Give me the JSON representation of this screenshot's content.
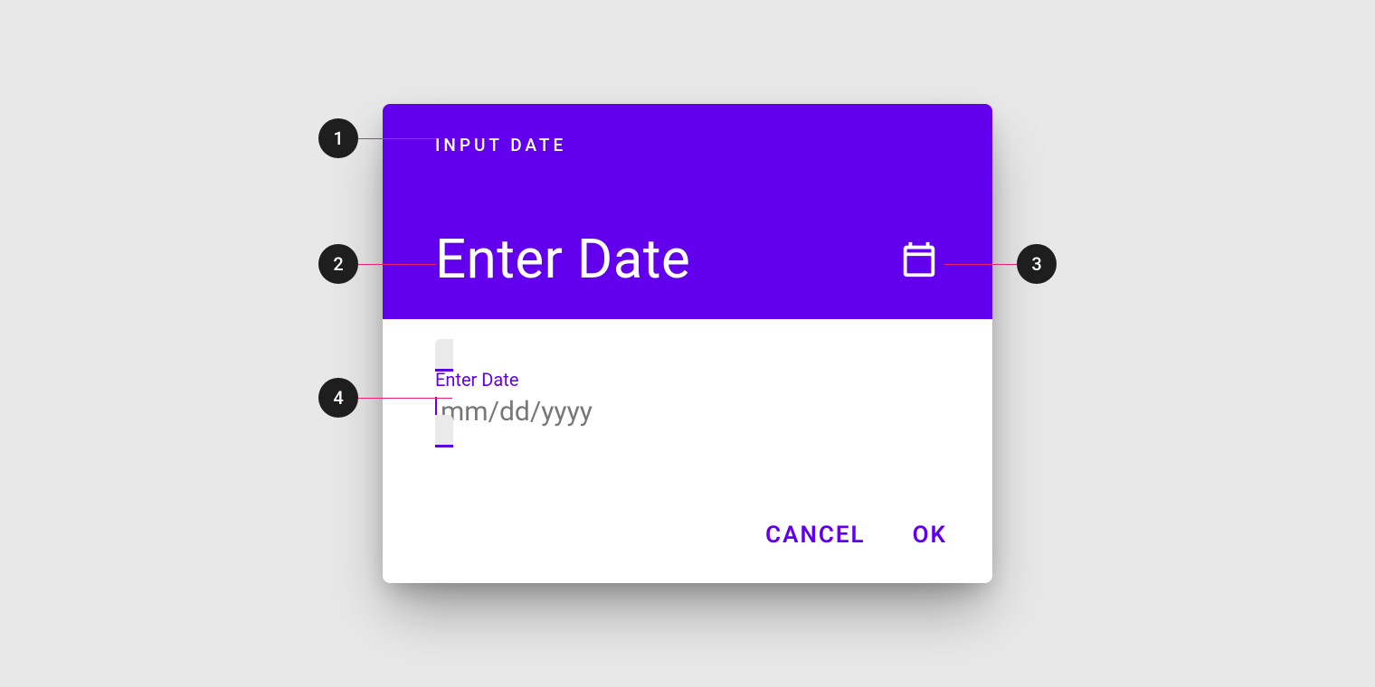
{
  "dialog": {
    "overline": "INPUT DATE",
    "headline": "Enter Date",
    "calendar_icon": "calendar-icon"
  },
  "field": {
    "label": "Enter Date",
    "placeholder": "mm/dd/yyyy",
    "value": ""
  },
  "actions": {
    "cancel": "CANCEL",
    "ok": "OK"
  },
  "annotations": {
    "b1": "1",
    "b2": "2",
    "b3": "3",
    "b4": "4"
  },
  "colors": {
    "primary": "#6200ee",
    "primary_dark": "#5a00e0",
    "accent_leader": "#ed2171",
    "surface": "#ffffff",
    "background": "#e8e8e8",
    "field_fill": "#eaeaea",
    "placeholder": "#777777",
    "badge_bg": "#1e1e1e"
  }
}
